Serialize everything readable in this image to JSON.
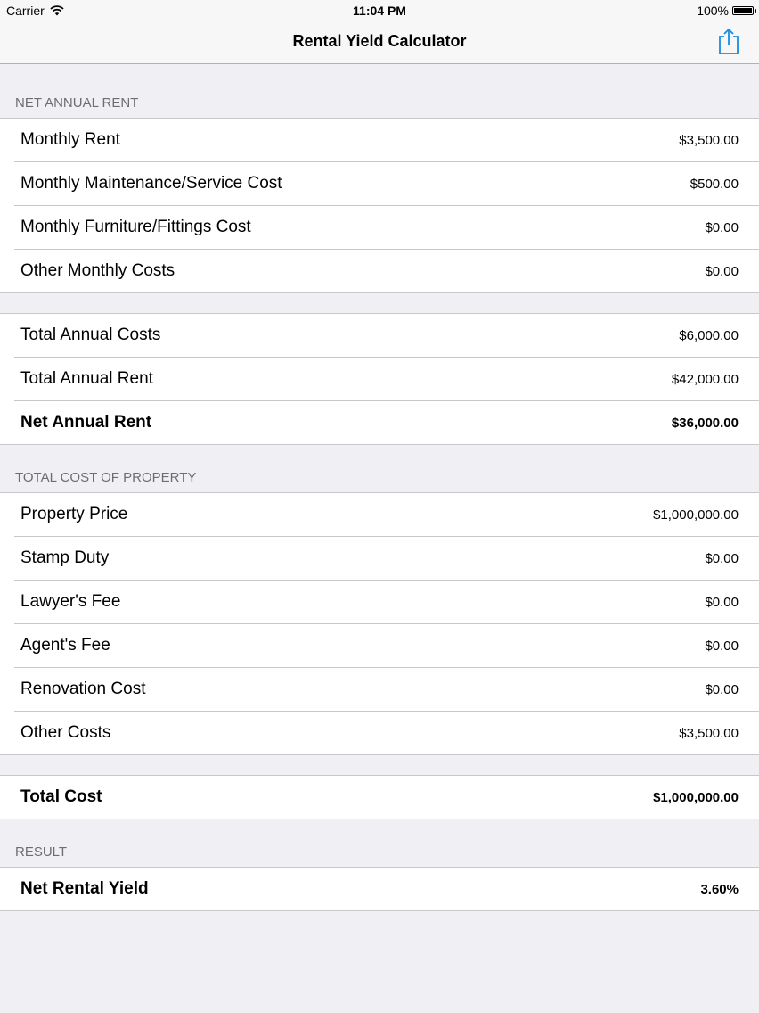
{
  "status_bar": {
    "carrier": "Carrier",
    "time": "11:04 PM",
    "battery": "100%"
  },
  "nav_bar": {
    "title": "Rental Yield Calculator",
    "share_icon": "share-icon",
    "accent_color": "#1a8ce0"
  },
  "sections": {
    "net_annual_rent": {
      "header": "NET ANNUAL RENT",
      "inputs": [
        {
          "label": "Monthly Rent",
          "value": "$3,500.00"
        },
        {
          "label": "Monthly Maintenance/Service Cost",
          "value": "$500.00"
        },
        {
          "label": "Monthly Furniture/Fittings Cost",
          "value": "$0.00"
        },
        {
          "label": "Other Monthly Costs",
          "value": "$0.00"
        }
      ],
      "totals": [
        {
          "label": "Total Annual Costs",
          "value": "$6,000.00"
        },
        {
          "label": "Total Annual Rent",
          "value": "$42,000.00"
        },
        {
          "label": "Net Annual Rent",
          "value": "$36,000.00"
        }
      ]
    },
    "total_cost_of_property": {
      "header": "TOTAL COST OF PROPERTY",
      "inputs": [
        {
          "label": "Property Price",
          "value": "$1,000,000.00"
        },
        {
          "label": "Stamp Duty",
          "value": "$0.00"
        },
        {
          "label": "Lawyer's Fee",
          "value": "$0.00"
        },
        {
          "label": "Agent's Fee",
          "value": "$0.00"
        },
        {
          "label": "Renovation Cost",
          "value": "$0.00"
        },
        {
          "label": "Other Costs",
          "value": "$3,500.00"
        }
      ],
      "totals": [
        {
          "label": "Total Cost",
          "value": "$1,000,000.00"
        }
      ]
    },
    "result": {
      "header": "RESULT",
      "rows": [
        {
          "label": "Net Rental Yield",
          "value": "3.60%"
        }
      ]
    }
  }
}
